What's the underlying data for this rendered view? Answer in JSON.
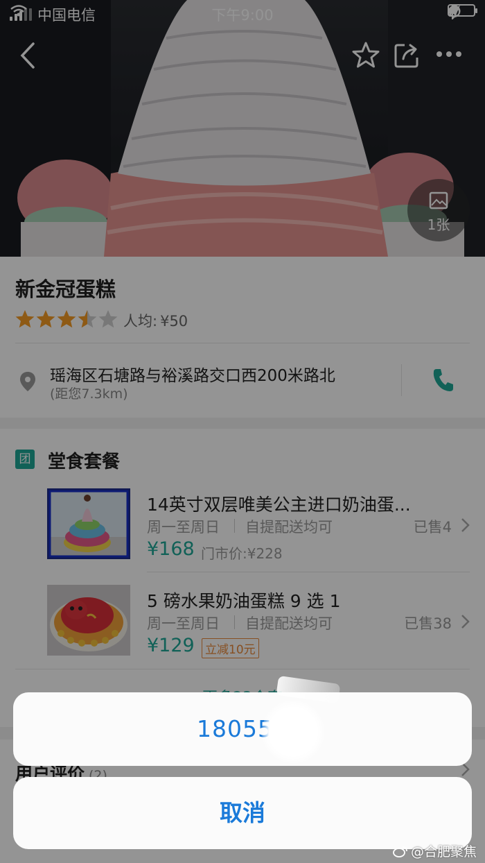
{
  "status_bar": {
    "carrier": "中国电信",
    "time": "下午9:00",
    "battery_level": 0.25
  },
  "nav": {
    "back_icon": "chevron-left-icon",
    "favorite_icon": "star-outline-icon",
    "share_icon": "share-icon",
    "more_icon": "more-dots-icon"
  },
  "hero": {
    "photo_count": "1张"
  },
  "shop": {
    "name": "新金冠蛋糕",
    "rating": 3.5,
    "rating_max": 5,
    "avg_label": "人均:",
    "avg_price": "¥50"
  },
  "address": {
    "text": "瑶海区石塘路与裕溪路交口西200米路北",
    "distance": "(距您7.3km)"
  },
  "section": {
    "badge": "团",
    "title": "堂食套餐"
  },
  "deals": [
    {
      "name": "14英寸双层唯美公主进口奶油蛋...",
      "days": "周一至周日",
      "mode": "自提配送均可",
      "price": "¥168",
      "orig": "门市价:¥228",
      "promo": "",
      "sold": "已售4"
    },
    {
      "name": "5 磅水果奶油蛋糕 9 选 1",
      "days": "周一至周日",
      "mode": "自提配送均可",
      "price": "¥129",
      "orig": "",
      "promo": "立减10元",
      "sold": "已售38"
    }
  ],
  "more_link": "更多23个套",
  "reviews": {
    "label": "用户评价",
    "count": "(2)"
  },
  "action_sheet": {
    "phone": "180551",
    "cancel": "取消"
  },
  "watermark": "@合肥聚焦",
  "colors": {
    "accent": "#1ea797",
    "star": "#f59b25",
    "action": "#1a7ad9",
    "promo": "#e8893a"
  }
}
